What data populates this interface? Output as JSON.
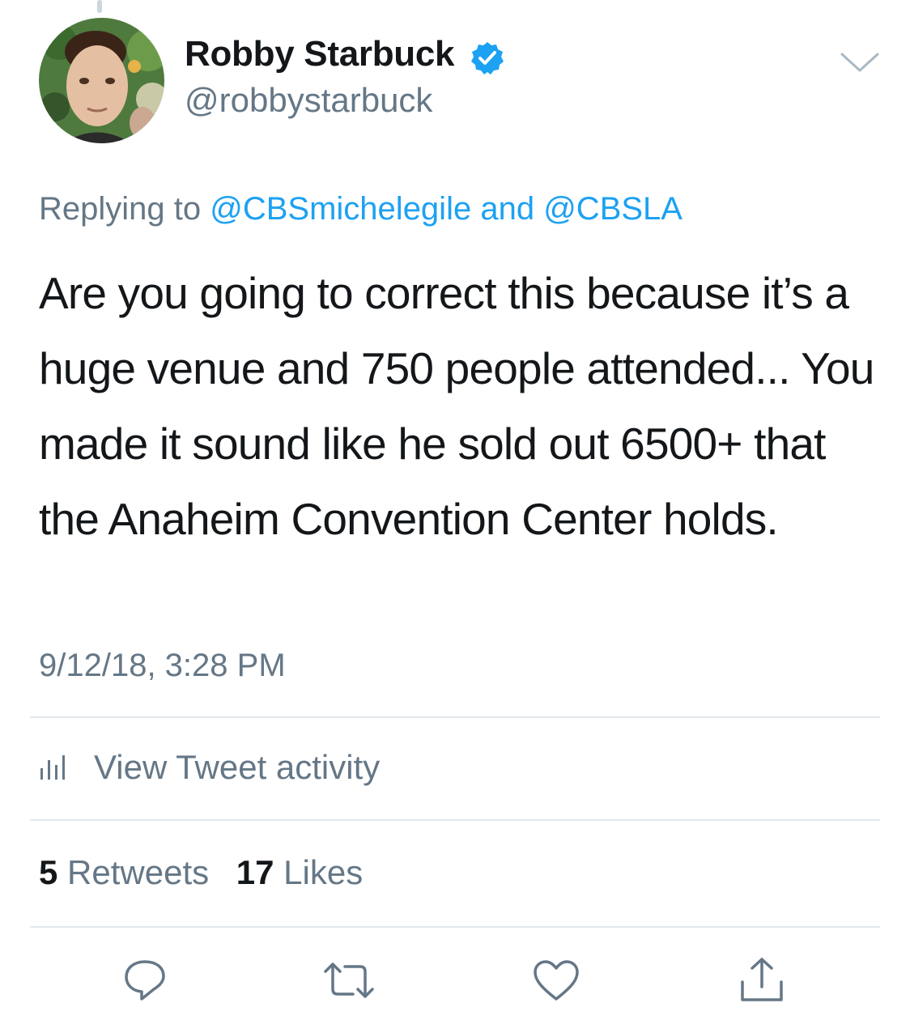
{
  "tweet": {
    "author": {
      "display_name": "Robby Starbuck",
      "handle": "@robbystarbuck",
      "verified": true
    },
    "reply": {
      "prefix": "Replying to",
      "mention_1": "@CBSmichelegile",
      "conjunction": "and",
      "mention_2": "@CBSLA"
    },
    "text": "Are you going to correct this because it’s a huge venue and 750 people attended... You made it sound like he sold out 6500+ that the Anaheim Convention Center holds.",
    "timestamp": "9/12/18, 3:28 PM"
  },
  "activity": {
    "label": "View Tweet activity",
    "icon": "bar-chart-icon"
  },
  "stats": {
    "retweets_count": "5",
    "retweets_label": "Retweets",
    "likes_count": "17",
    "likes_label": "Likes"
  },
  "actions": [
    {
      "icon": "reply-icon"
    },
    {
      "icon": "retweet-icon"
    },
    {
      "icon": "like-icon"
    },
    {
      "icon": "share-icon"
    }
  ],
  "colors": {
    "text": "#14171a",
    "secondary": "#657786",
    "link": "#1da1f2",
    "divider": "#e1e8ed",
    "verified": "#1da1f2"
  }
}
